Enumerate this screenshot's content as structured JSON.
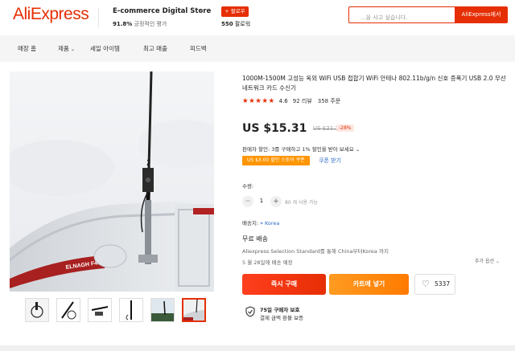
{
  "header": {
    "logo": "AliExpress",
    "store_name": "E-commerce Digital Store",
    "store_rating_value": "91.8%",
    "store_rating_label": "긍정적인 평가",
    "follow_label": "+ 팔로우",
    "followers_value": "550",
    "followers_label": "팔로워",
    "search_placeholder": "...을 사고 싶습니다.",
    "search_button": "AliExpress에서"
  },
  "nav": {
    "items": [
      "매장 홈",
      "제품",
      "세일 아이템",
      "최고 매출",
      "피드백"
    ]
  },
  "product": {
    "title": "1000M-1500M 고성능 옥외 WiFi USB 접합기 WiFi 안테나 802.11b/g/n 신호 증폭기 USB 2.0 무선 네트워크 카드 수신기",
    "stars": "★★★★★",
    "rating": "4.6",
    "reviews": "92 리뷰",
    "orders": "358 주문",
    "price": "US $15.31",
    "old_price": "US $21.26",
    "discount": "-28%",
    "seller_promo": "판매자 할인: 3를 구매하고 1% 할인을 받아 보세요",
    "coupon_tag": "US $3.00 할인 스토어 쿠폰",
    "coupon_link": "쿠폰 받기",
    "qty_label": "수량:",
    "qty_value": "1",
    "qty_available": "80 개 사용 가능",
    "ship_to_label": "배송지:",
    "ship_to_value": "Korea",
    "free_shipping": "무료 배송",
    "ship_detail": "Aliexpress Selection Standard를 통해 China부터Korea 까지",
    "delivery_date": "5 월 28일에 배송 예정",
    "more_options": "추가 옵션",
    "buy_now": "즉시 구매",
    "add_to_cart": "카트에 넣기",
    "wishlist_count": "5337",
    "guarantee_title": "75일 구매자 보호",
    "guarantee_sub": "결제 금액 환불 보증"
  },
  "colors": {
    "brand": "#e62e04",
    "cart": "#ff8a00",
    "coupon": "#ff9500",
    "link": "#2e69c6"
  }
}
